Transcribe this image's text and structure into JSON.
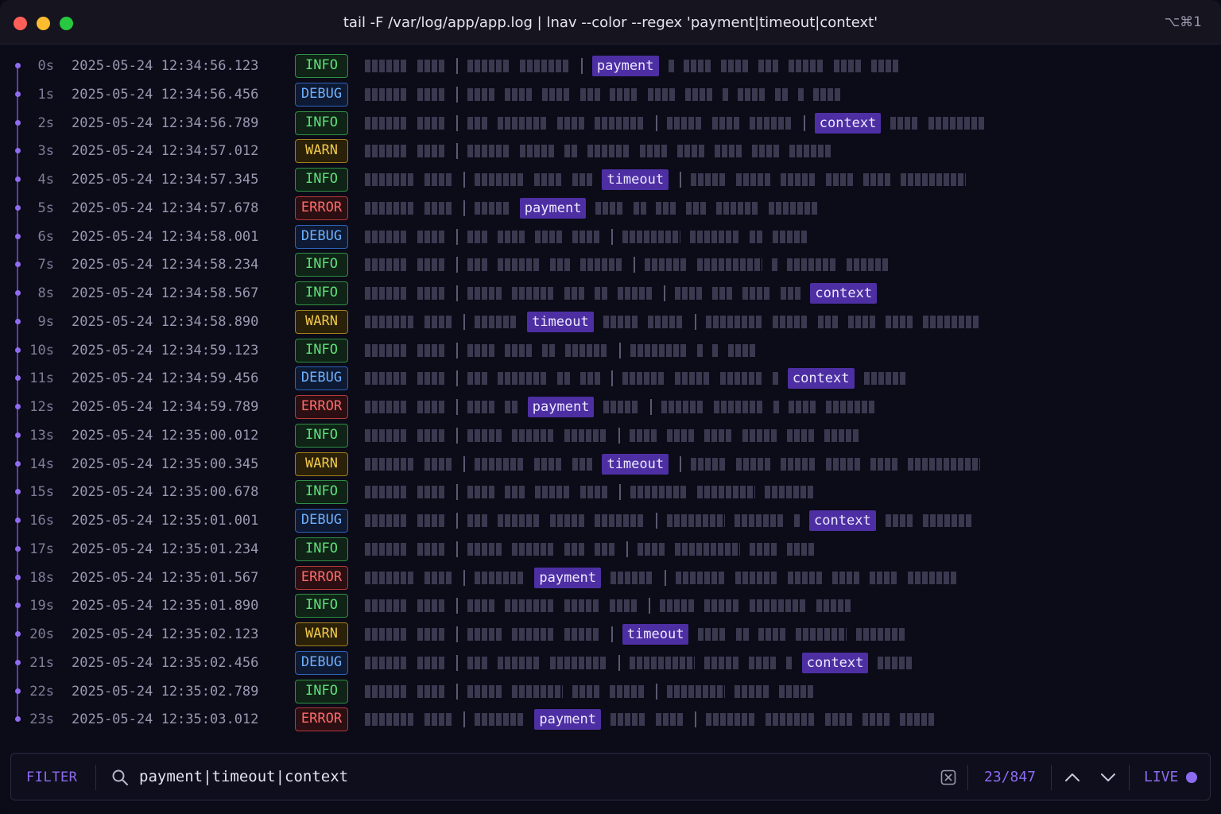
{
  "window": {
    "title": "tail -F /var/log/app/app.log | lnav --color --regex 'payment|timeout|context'",
    "shortcut": "⌥⌘1"
  },
  "log": {
    "rows": [
      {
        "tick": "0s",
        "ts": "2025-05-24 12:34:56.123",
        "level": "INFO",
        "msg": [
          {
            "b": 6
          },
          {
            "b": 4
          },
          {
            "s": 1
          },
          {
            "b": 6
          },
          {
            "b": 7
          },
          {
            "s": 1
          },
          {
            "h": "payment"
          },
          {
            "b": 1
          },
          {
            "b": 4
          },
          {
            "b": 4
          },
          {
            "b": 3
          },
          {
            "b": 5
          },
          {
            "b": 4
          },
          {
            "b": 4
          }
        ]
      },
      {
        "tick": "1s",
        "ts": "2025-05-24 12:34:56.456",
        "level": "DEBUG",
        "msg": [
          {
            "b": 6
          },
          {
            "b": 4
          },
          {
            "s": 1
          },
          {
            "b": 4
          },
          {
            "b": 4
          },
          {
            "b": 4
          },
          {
            "b": 3
          },
          {
            "b": 4
          },
          {
            "b": 4
          },
          {
            "b": 4
          },
          {
            "b": 1
          },
          {
            "b": 4
          },
          {
            "b": 2
          },
          {
            "b": 1
          },
          {
            "b": 4
          }
        ]
      },
      {
        "tick": "2s",
        "ts": "2025-05-24 12:34:56.789",
        "level": "INFO",
        "msg": [
          {
            "b": 6
          },
          {
            "b": 4
          },
          {
            "s": 1
          },
          {
            "b": 3
          },
          {
            "b": 7
          },
          {
            "b": 4
          },
          {
            "b": 7
          },
          {
            "s": 1
          },
          {
            "b": 5
          },
          {
            "b": 4
          },
          {
            "b": 6
          },
          {
            "s": 1
          },
          {
            "h": "context"
          },
          {
            "b": 4
          },
          {
            "b": 8
          }
        ]
      },
      {
        "tick": "3s",
        "ts": "2025-05-24 12:34:57.012",
        "level": "WARN",
        "msg": [
          {
            "b": 6
          },
          {
            "b": 4
          },
          {
            "s": 1
          },
          {
            "b": 6
          },
          {
            "b": 5
          },
          {
            "b": 2
          },
          {
            "b": 6
          },
          {
            "b": 4
          },
          {
            "b": 4
          },
          {
            "b": 4
          },
          {
            "b": 4
          },
          {
            "b": 6
          }
        ]
      },
      {
        "tick": "4s",
        "ts": "2025-05-24 12:34:57.345",
        "level": "INFO",
        "msg": [
          {
            "b": 7
          },
          {
            "b": 4
          },
          {
            "s": 1
          },
          {
            "b": 7
          },
          {
            "b": 4
          },
          {
            "b": 3
          },
          {
            "h": "timeout"
          },
          {
            "s": 1
          },
          {
            "b": 5
          },
          {
            "b": 5
          },
          {
            "b": 5
          },
          {
            "b": 4
          },
          {
            "b": 4
          },
          {
            "b": 9
          }
        ]
      },
      {
        "tick": "5s",
        "ts": "2025-05-24 12:34:57.678",
        "level": "ERROR",
        "msg": [
          {
            "b": 7
          },
          {
            "b": 4
          },
          {
            "s": 1
          },
          {
            "b": 5
          },
          {
            "h": "payment"
          },
          {
            "b": 4
          },
          {
            "b": 2
          },
          {
            "b": 3
          },
          {
            "b": 3
          },
          {
            "b": 6
          },
          {
            "b": 7
          }
        ]
      },
      {
        "tick": "6s",
        "ts": "2025-05-24 12:34:58.001",
        "level": "DEBUG",
        "msg": [
          {
            "b": 6
          },
          {
            "b": 4
          },
          {
            "s": 1
          },
          {
            "b": 3
          },
          {
            "b": 4
          },
          {
            "b": 4
          },
          {
            "b": 4
          },
          {
            "s": 1
          },
          {
            "b": 8
          },
          {
            "b": 7
          },
          {
            "b": 2
          },
          {
            "b": 5
          }
        ]
      },
      {
        "tick": "7s",
        "ts": "2025-05-24 12:34:58.234",
        "level": "INFO",
        "msg": [
          {
            "b": 6
          },
          {
            "b": 4
          },
          {
            "s": 1
          },
          {
            "b": 3
          },
          {
            "b": 6
          },
          {
            "b": 3
          },
          {
            "b": 6
          },
          {
            "s": 1
          },
          {
            "b": 6
          },
          {
            "b": 9
          },
          {
            "b": 1
          },
          {
            "b": 7
          },
          {
            "b": 6
          }
        ]
      },
      {
        "tick": "8s",
        "ts": "2025-05-24 12:34:58.567",
        "level": "INFO",
        "msg": [
          {
            "b": 6
          },
          {
            "b": 4
          },
          {
            "s": 1
          },
          {
            "b": 5
          },
          {
            "b": 6
          },
          {
            "b": 3
          },
          {
            "b": 2
          },
          {
            "b": 5
          },
          {
            "s": 1
          },
          {
            "b": 4
          },
          {
            "b": 3
          },
          {
            "b": 4
          },
          {
            "b": 3
          },
          {
            "h": "context"
          }
        ]
      },
      {
        "tick": "9s",
        "ts": "2025-05-24 12:34:58.890",
        "level": "WARN",
        "msg": [
          {
            "b": 7
          },
          {
            "b": 4
          },
          {
            "s": 1
          },
          {
            "b": 6
          },
          {
            "h": "timeout"
          },
          {
            "b": 5
          },
          {
            "b": 5
          },
          {
            "s": 1
          },
          {
            "b": 8
          },
          {
            "b": 5
          },
          {
            "b": 3
          },
          {
            "b": 4
          },
          {
            "b": 4
          },
          {
            "b": 8
          }
        ]
      },
      {
        "tick": "10s",
        "ts": "2025-05-24 12:34:59.123",
        "level": "INFO",
        "msg": [
          {
            "b": 6
          },
          {
            "b": 4
          },
          {
            "s": 1
          },
          {
            "b": 4
          },
          {
            "b": 4
          },
          {
            "b": 2
          },
          {
            "b": 6
          },
          {
            "s": 1
          },
          {
            "b": 8
          },
          {
            "b": 1
          },
          {
            "b": 1
          },
          {
            "b": 4
          }
        ]
      },
      {
        "tick": "11s",
        "ts": "2025-05-24 12:34:59.456",
        "level": "DEBUG",
        "msg": [
          {
            "b": 6
          },
          {
            "b": 4
          },
          {
            "s": 1
          },
          {
            "b": 3
          },
          {
            "b": 7
          },
          {
            "b": 2
          },
          {
            "b": 3
          },
          {
            "s": 1
          },
          {
            "b": 6
          },
          {
            "b": 5
          },
          {
            "b": 6
          },
          {
            "b": 1
          },
          {
            "h": "context"
          },
          {
            "b": 6
          }
        ]
      },
      {
        "tick": "12s",
        "ts": "2025-05-24 12:34:59.789",
        "level": "ERROR",
        "msg": [
          {
            "b": 6
          },
          {
            "b": 4
          },
          {
            "s": 1
          },
          {
            "b": 4
          },
          {
            "b": 2
          },
          {
            "h": "payment"
          },
          {
            "b": 5
          },
          {
            "s": 1
          },
          {
            "b": 6
          },
          {
            "b": 7
          },
          {
            "b": 1
          },
          {
            "b": 4
          },
          {
            "b": 7
          }
        ]
      },
      {
        "tick": "13s",
        "ts": "2025-05-24 12:35:00.012",
        "level": "INFO",
        "msg": [
          {
            "b": 6
          },
          {
            "b": 4
          },
          {
            "s": 1
          },
          {
            "b": 5
          },
          {
            "b": 6
          },
          {
            "b": 6
          },
          {
            "s": 1
          },
          {
            "b": 4
          },
          {
            "b": 4
          },
          {
            "b": 4
          },
          {
            "b": 5
          },
          {
            "b": 4
          },
          {
            "b": 5
          }
        ]
      },
      {
        "tick": "14s",
        "ts": "2025-05-24 12:35:00.345",
        "level": "WARN",
        "msg": [
          {
            "b": 7
          },
          {
            "b": 4
          },
          {
            "s": 1
          },
          {
            "b": 7
          },
          {
            "b": 4
          },
          {
            "b": 3
          },
          {
            "h": "timeout"
          },
          {
            "s": 1
          },
          {
            "b": 5
          },
          {
            "b": 5
          },
          {
            "b": 5
          },
          {
            "b": 5
          },
          {
            "b": 4
          },
          {
            "b": 10
          }
        ]
      },
      {
        "tick": "15s",
        "ts": "2025-05-24 12:35:00.678",
        "level": "INFO",
        "msg": [
          {
            "b": 6
          },
          {
            "b": 4
          },
          {
            "s": 1
          },
          {
            "b": 4
          },
          {
            "b": 3
          },
          {
            "b": 5
          },
          {
            "b": 4
          },
          {
            "s": 1
          },
          {
            "b": 8
          },
          {
            "b": 8
          },
          {
            "b": 7
          }
        ]
      },
      {
        "tick": "16s",
        "ts": "2025-05-24 12:35:01.001",
        "level": "DEBUG",
        "msg": [
          {
            "b": 6
          },
          {
            "b": 4
          },
          {
            "s": 1
          },
          {
            "b": 3
          },
          {
            "b": 6
          },
          {
            "b": 5
          },
          {
            "b": 7
          },
          {
            "s": 1
          },
          {
            "b": 8
          },
          {
            "b": 7
          },
          {
            "b": 1
          },
          {
            "h": "context"
          },
          {
            "b": 4
          },
          {
            "b": 7
          }
        ]
      },
      {
        "tick": "17s",
        "ts": "2025-05-24 12:35:01.234",
        "level": "INFO",
        "msg": [
          {
            "b": 6
          },
          {
            "b": 4
          },
          {
            "s": 1
          },
          {
            "b": 5
          },
          {
            "b": 6
          },
          {
            "b": 3
          },
          {
            "b": 3
          },
          {
            "s": 1
          },
          {
            "b": 4
          },
          {
            "b": 9
          },
          {
            "b": 4
          },
          {
            "b": 4
          }
        ]
      },
      {
        "tick": "18s",
        "ts": "2025-05-24 12:35:01.567",
        "level": "ERROR",
        "msg": [
          {
            "b": 7
          },
          {
            "b": 4
          },
          {
            "s": 1
          },
          {
            "b": 7
          },
          {
            "h": "payment"
          },
          {
            "b": 6
          },
          {
            "s": 1
          },
          {
            "b": 7
          },
          {
            "b": 6
          },
          {
            "b": 5
          },
          {
            "b": 4
          },
          {
            "b": 4
          },
          {
            "b": 7
          }
        ]
      },
      {
        "tick": "19s",
        "ts": "2025-05-24 12:35:01.890",
        "level": "INFO",
        "msg": [
          {
            "b": 6
          },
          {
            "b": 4
          },
          {
            "s": 1
          },
          {
            "b": 4
          },
          {
            "b": 7
          },
          {
            "b": 5
          },
          {
            "b": 4
          },
          {
            "s": 1
          },
          {
            "b": 5
          },
          {
            "b": 5
          },
          {
            "b": 8
          },
          {
            "b": 5
          }
        ]
      },
      {
        "tick": "20s",
        "ts": "2025-05-24 12:35:02.123",
        "level": "WARN",
        "msg": [
          {
            "b": 6
          },
          {
            "b": 4
          },
          {
            "s": 1
          },
          {
            "b": 5
          },
          {
            "b": 6
          },
          {
            "b": 5
          },
          {
            "s": 1
          },
          {
            "h": "timeout"
          },
          {
            "b": 4
          },
          {
            "b": 2
          },
          {
            "b": 4
          },
          {
            "b": 7
          },
          {
            "b": 7
          }
        ]
      },
      {
        "tick": "21s",
        "ts": "2025-05-24 12:35:02.456",
        "level": "DEBUG",
        "msg": [
          {
            "b": 6
          },
          {
            "b": 4
          },
          {
            "s": 1
          },
          {
            "b": 3
          },
          {
            "b": 6
          },
          {
            "b": 8
          },
          {
            "s": 1
          },
          {
            "b": 9
          },
          {
            "b": 5
          },
          {
            "b": 4
          },
          {
            "b": 1
          },
          {
            "h": "context"
          },
          {
            "b": 5
          }
        ]
      },
      {
        "tick": "22s",
        "ts": "2025-05-24 12:35:02.789",
        "level": "INFO",
        "msg": [
          {
            "b": 6
          },
          {
            "b": 4
          },
          {
            "s": 1
          },
          {
            "b": 5
          },
          {
            "b": 7
          },
          {
            "b": 4
          },
          {
            "b": 5
          },
          {
            "s": 1
          },
          {
            "b": 8
          },
          {
            "b": 5
          },
          {
            "b": 5
          }
        ]
      },
      {
        "tick": "23s",
        "ts": "2025-05-24 12:35:03.012",
        "level": "ERROR",
        "msg": [
          {
            "b": 7
          },
          {
            "b": 4
          },
          {
            "s": 1
          },
          {
            "b": 7
          },
          {
            "h": "payment"
          },
          {
            "b": 5
          },
          {
            "b": 4
          },
          {
            "s": 1
          },
          {
            "b": 7
          },
          {
            "b": 7
          },
          {
            "b": 4
          },
          {
            "b": 4
          },
          {
            "b": 5
          }
        ]
      }
    ]
  },
  "filter": {
    "label": "FILTER",
    "query": "payment|timeout|context",
    "count": "23/847",
    "live_label": "LIVE",
    "icons": {
      "search": "search-icon",
      "clear": "clear-icon",
      "prev": "chevron-up-icon",
      "next": "chevron-down-icon"
    }
  },
  "colors": {
    "accent": "#8c6bf0",
    "highlight": "#4d2fa3",
    "info": "#5fe07a",
    "debug": "#6eb0ff",
    "warn": "#f2c94c",
    "error": "#ff6b6b"
  }
}
